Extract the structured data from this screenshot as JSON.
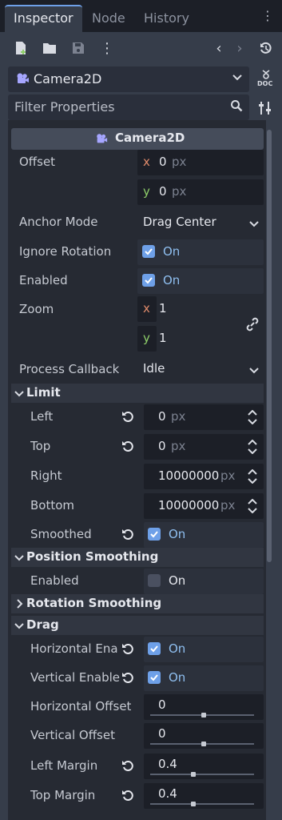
{
  "tabs": [
    {
      "label": "Inspector",
      "active": true
    },
    {
      "label": "Node",
      "active": false
    },
    {
      "label": "History",
      "active": false
    }
  ],
  "toolbar": {
    "icons": [
      "new-resource-icon",
      "open-folder-icon",
      "save-icon",
      "more-icon",
      "back-icon",
      "forward-icon",
      "history-icon"
    ]
  },
  "selector": {
    "node_name": "Camera2D",
    "doc_label": "DOC"
  },
  "filter": {
    "placeholder": "Filter Properties"
  },
  "header": {
    "title": "Camera2D"
  },
  "props": {
    "offset": {
      "label": "Offset",
      "x_axis": "x",
      "x": "0",
      "x_unit": "px",
      "y_axis": "y",
      "y": "0",
      "y_unit": "px"
    },
    "anchor_mode": {
      "label": "Anchor Mode",
      "value": "Drag Center"
    },
    "ignore_rotation": {
      "label": "Ignore Rotation",
      "state": "On"
    },
    "enabled": {
      "label": "Enabled",
      "state": "On"
    },
    "zoom": {
      "label": "Zoom",
      "x_axis": "x",
      "x": "1",
      "y_axis": "y",
      "y": "1"
    },
    "process_callback": {
      "label": "Process Callback",
      "value": "Idle"
    }
  },
  "limit": {
    "title": "Limit",
    "left": {
      "label": "Left",
      "value": "0",
      "unit": "px"
    },
    "top": {
      "label": "Top",
      "value": "0",
      "unit": "px"
    },
    "right": {
      "label": "Right",
      "value": "10000000",
      "unit": "px"
    },
    "bottom": {
      "label": "Bottom",
      "value": "10000000",
      "unit": "px"
    },
    "smoothed": {
      "label": "Smoothed",
      "state": "On"
    }
  },
  "position_smoothing": {
    "title": "Position Smoothing",
    "enabled": {
      "label": "Enabled",
      "state": "On",
      "checked": false
    }
  },
  "rotation_smoothing": {
    "title": "Rotation Smoothing"
  },
  "drag": {
    "title": "Drag",
    "horizontal_enabled": {
      "label": "Horizontal Ena",
      "state": "On"
    },
    "vertical_enabled": {
      "label": "Vertical Enable",
      "state": "On"
    },
    "horizontal_offset": {
      "label": "Horizontal Offset",
      "value": "0",
      "level": 0.5
    },
    "vertical_offset": {
      "label": "Vertical Offset",
      "value": "0",
      "level": 0.5
    },
    "left_margin": {
      "label": "Left Margin",
      "value": "0.4",
      "level": 0.4
    },
    "top_margin": {
      "label": "Top Margin",
      "value": "0.4",
      "level": 0.4
    }
  },
  "colors": {
    "accent": "#6ea0e8",
    "axis_x": "#e08b6b",
    "axis_y": "#8fcf6a",
    "on_text": "#8fbff0"
  }
}
